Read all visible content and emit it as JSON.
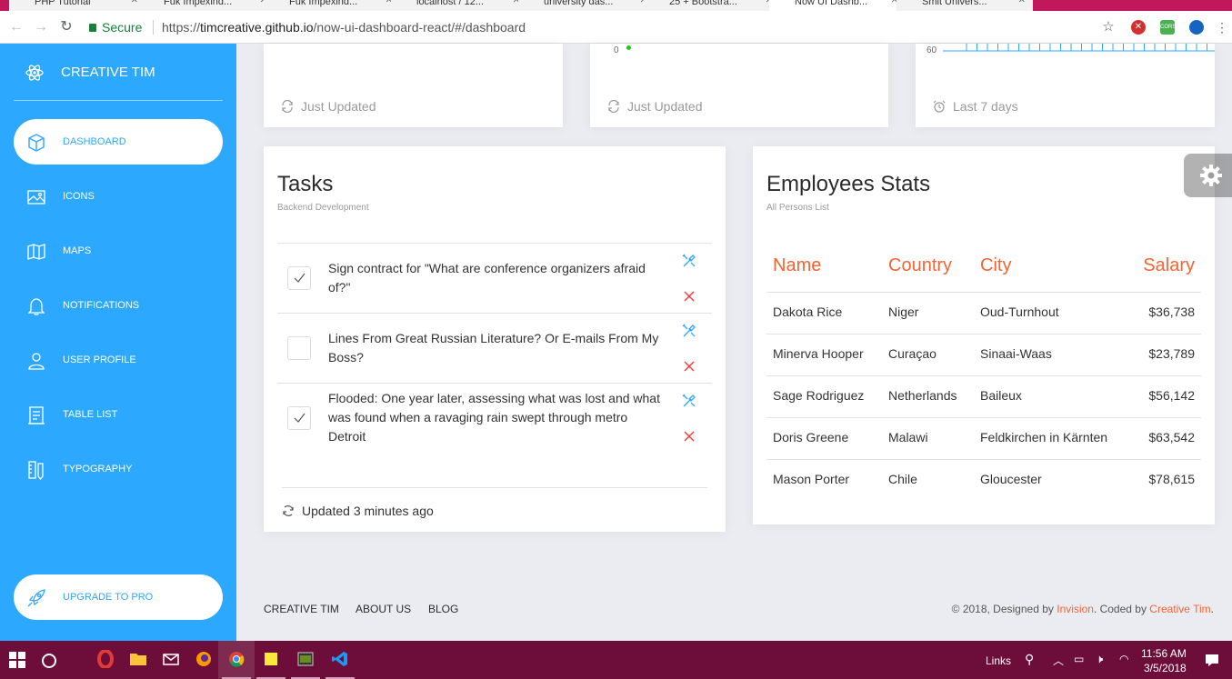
{
  "browser": {
    "tabs": [
      {
        "title": "PHP Tutorial"
      },
      {
        "title": "Fuk Impexind..."
      },
      {
        "title": "Fuk Impexind..."
      },
      {
        "title": "localhost / 12..."
      },
      {
        "title": "university das..."
      },
      {
        "title": "25 + Bootstra..."
      },
      {
        "title": "Now UI Dashb..."
      },
      {
        "title": "Smit Univers..."
      }
    ],
    "secure_label": "Secure",
    "url_scheme": "https://",
    "url_host": "timcreative.github.io",
    "url_path": "/now-ui-dashboard-react/#/dashboard",
    "extension_cors": "CORS"
  },
  "sidebar": {
    "brand": "CREATIVE TIM",
    "items": [
      {
        "label": "DASHBOARD",
        "icon": "design-cube-icon",
        "active": true
      },
      {
        "label": "ICONS",
        "icon": "image-icon"
      },
      {
        "label": "MAPS",
        "icon": "map-icon"
      },
      {
        "label": "NOTIFICATIONS",
        "icon": "bell-icon"
      },
      {
        "label": "USER PROFILE",
        "icon": "user-icon"
      },
      {
        "label": "TABLE LIST",
        "icon": "file-paper-icon"
      },
      {
        "label": "TYPOGRAPHY",
        "icon": "ruler-pencil-icon"
      }
    ],
    "upgrade": "UPGRADE TO PRO"
  },
  "top_cards": [
    {
      "footer": "Just Updated",
      "icon": "refresh-icon"
    },
    {
      "footer": "Just Updated",
      "icon": "refresh-icon",
      "axis_label": "0"
    },
    {
      "footer": "Last 7 days",
      "icon": "alarm-clock-icon",
      "axis_label": "60"
    }
  ],
  "tasks": {
    "title": "Tasks",
    "category": "Backend Development",
    "items": [
      {
        "text": "Sign contract for \"What are conference organizers afraid of?\"",
        "checked": true
      },
      {
        "text": "Lines From Great Russian Literature? Or E-mails From My Boss?",
        "checked": false
      },
      {
        "text": "Flooded: One year later, assessing what was lost and what was found when a ravaging rain swept through metro Detroit",
        "checked": true
      }
    ],
    "footer": "Updated 3 minutes ago"
  },
  "employees": {
    "title": "Employees Stats",
    "category": "All Persons List",
    "headers": [
      "Name",
      "Country",
      "City",
      "Salary"
    ],
    "rows": [
      [
        "Dakota Rice",
        "Niger",
        "Oud-Turnhout",
        "$36,738"
      ],
      [
        "Minerva Hooper",
        "Curaçao",
        "Sinaai-Waas",
        "$23,789"
      ],
      [
        "Sage Rodriguez",
        "Netherlands",
        "Baileux",
        "$56,142"
      ],
      [
        "Doris Greene",
        "Malawi",
        "Feldkirchen in Kärnten",
        "$63,542"
      ],
      [
        "Mason Porter",
        "Chile",
        "Gloucester",
        "$78,615"
      ]
    ]
  },
  "footer": {
    "links": [
      "CREATIVE TIM",
      "ABOUT US",
      "BLOG"
    ],
    "copyright_prefix": "© 2018, Designed by ",
    "copyright_invision": "Invision",
    "copyright_mid": ". Coded by ",
    "copyright_tim": "Creative Tim",
    "copyright_suffix": "."
  },
  "taskbar": {
    "links_label": "Links",
    "time": "11:56 AM",
    "date": "3/5/2018"
  },
  "colors": {
    "sidebar": "#2ca8ff",
    "accent": "#f96332",
    "taskbar": "#6d0e3a"
  }
}
